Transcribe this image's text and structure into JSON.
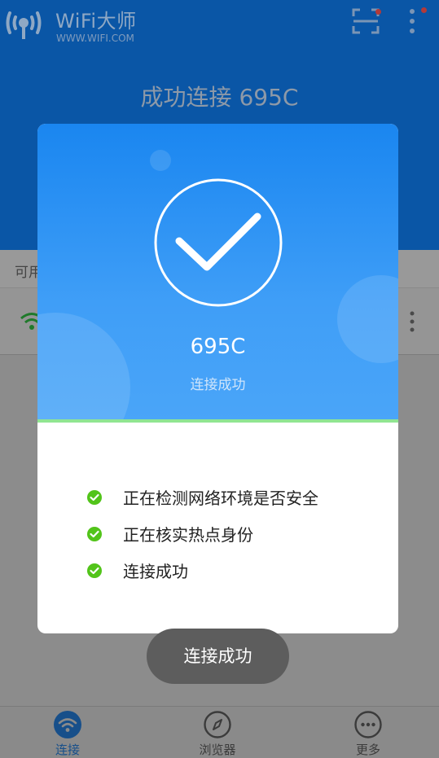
{
  "app": {
    "title": "WiFi大师",
    "url": "WWW.WIFI.COM",
    "heading": "成功连接 695C"
  },
  "list": {
    "header": "可用"
  },
  "dialog": {
    "ssid": "695C",
    "status": "连接成功",
    "progress": 1.0,
    "steps": [
      {
        "text": "正在检测网络环境是否安全",
        "icon": "check-circle-icon",
        "color": "#52c41a"
      },
      {
        "text": "正在核实热点身份",
        "icon": "check-circle-icon",
        "color": "#52c41a"
      },
      {
        "text": "连接成功",
        "icon": "check-circle-icon",
        "color": "#52c41a"
      }
    ]
  },
  "toast": {
    "text": "连接成功"
  },
  "bottom_nav": {
    "items": [
      {
        "label": "连接",
        "icon": "wifi-icon",
        "active": true
      },
      {
        "label": "浏览器",
        "icon": "compass-icon",
        "active": false
      },
      {
        "label": "更多",
        "icon": "more-dots-icon",
        "active": false
      }
    ]
  },
  "colors": {
    "topbar": "#0a56a6",
    "dialog_gradient_top": "#1a86f0",
    "dialog_gradient_bottom": "#4aa5f8",
    "progress": "#90e592",
    "success_green": "#52c41a"
  }
}
